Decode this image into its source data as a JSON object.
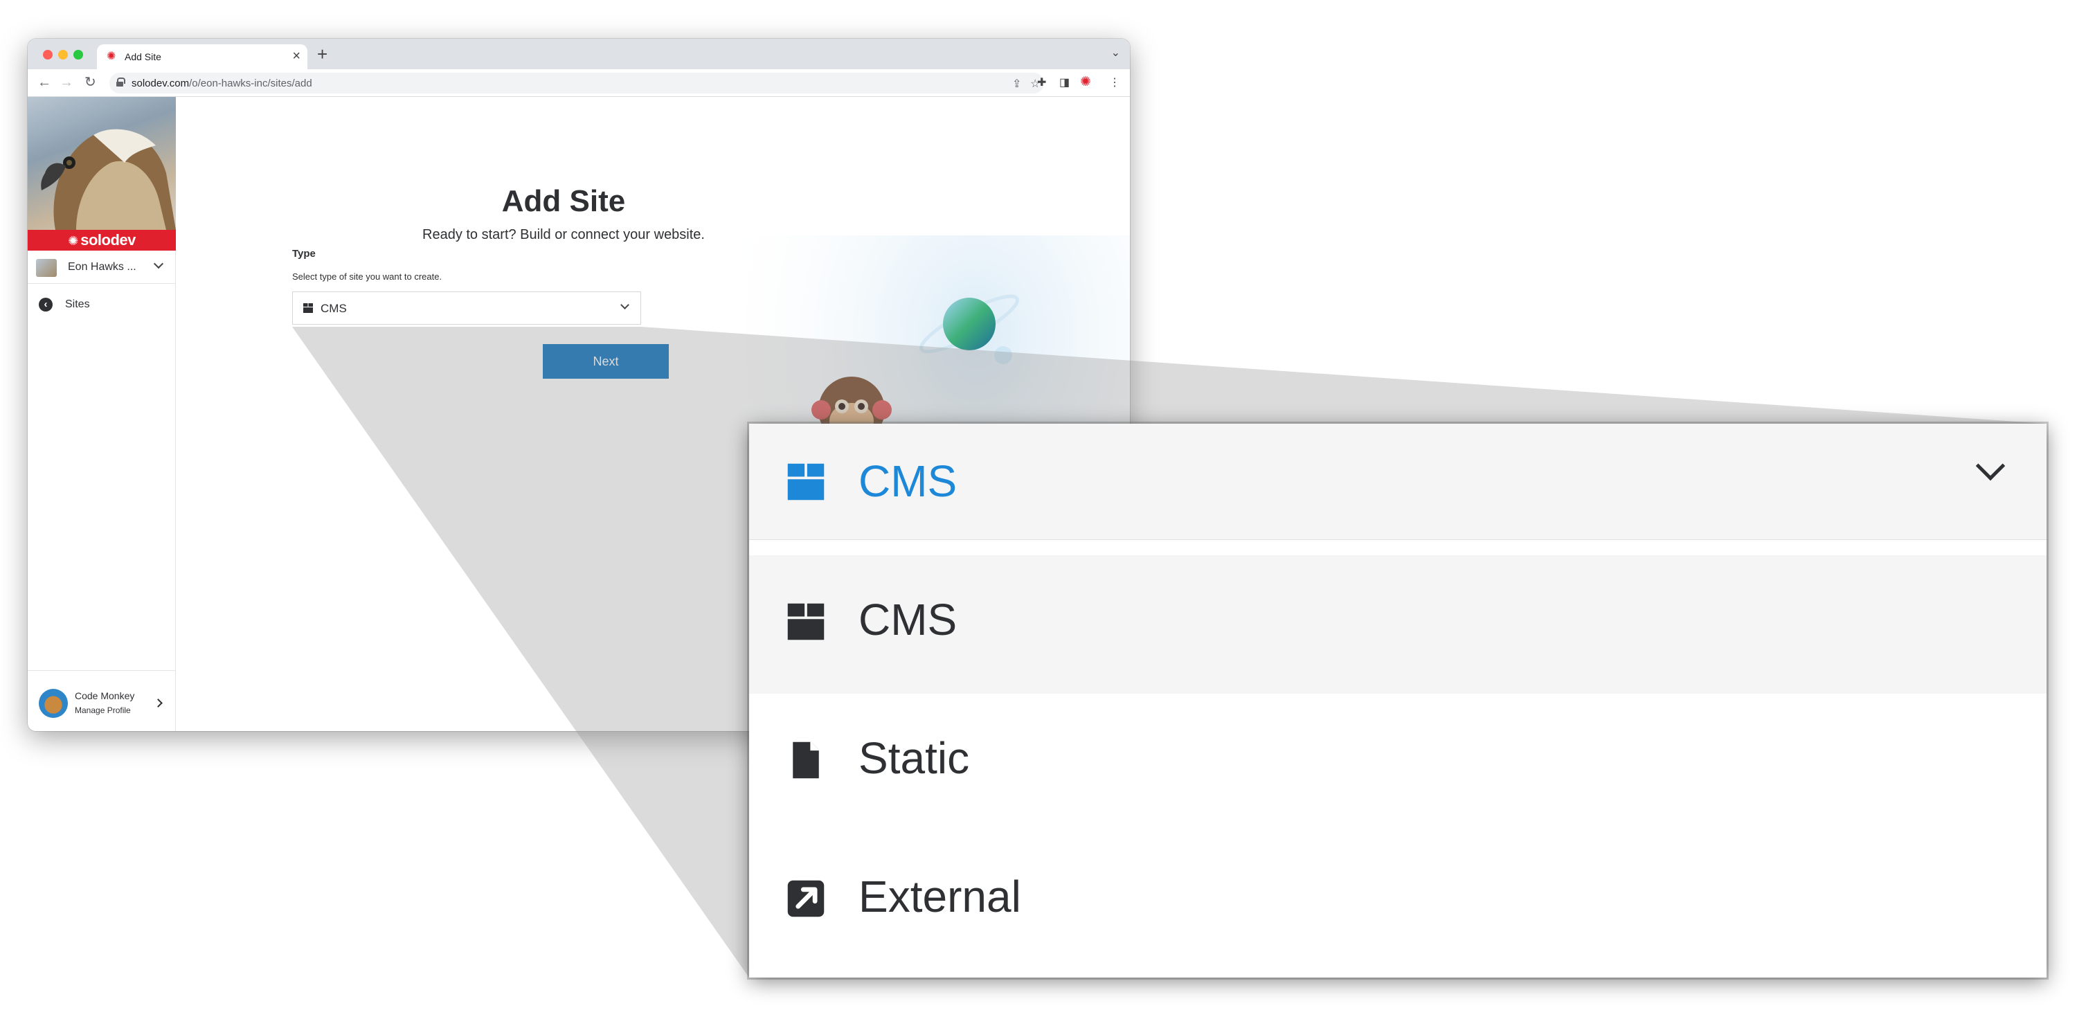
{
  "browser": {
    "tab_title": "Add Site",
    "tab_close": "×",
    "new_tab": "+",
    "url_host": "solodev.com",
    "url_path": "/o/eon-hawks-inc/sites/add"
  },
  "sidebar": {
    "brand": "solodev",
    "org_name": "Eon Hawks ...",
    "nav_items": [
      {
        "label": "Sites",
        "icon": "arrow-left-circle-icon"
      }
    ],
    "profile": {
      "name": "Code Monkey",
      "action": "Manage Profile"
    }
  },
  "main": {
    "title": "Add Site",
    "subtitle": "Ready to start? Build or connect your website.",
    "type_field": {
      "label": "Type",
      "help": "Select type of site you want to create.",
      "selected": "CMS",
      "selected_icon": "box-icon"
    },
    "next_button": "Next"
  },
  "zoom": {
    "selected": "CMS",
    "selected_color": "#1e88d8",
    "options": [
      {
        "label": "CMS",
        "icon": "box-icon",
        "highlighted": true
      },
      {
        "label": "Static",
        "icon": "file-icon",
        "highlighted": false
      },
      {
        "label": "External",
        "icon": "external-link-icon",
        "highlighted": false
      }
    ]
  },
  "colors": {
    "brand_red": "#e0202c",
    "primary_button": "#0b72be",
    "text": "#2f3033"
  }
}
